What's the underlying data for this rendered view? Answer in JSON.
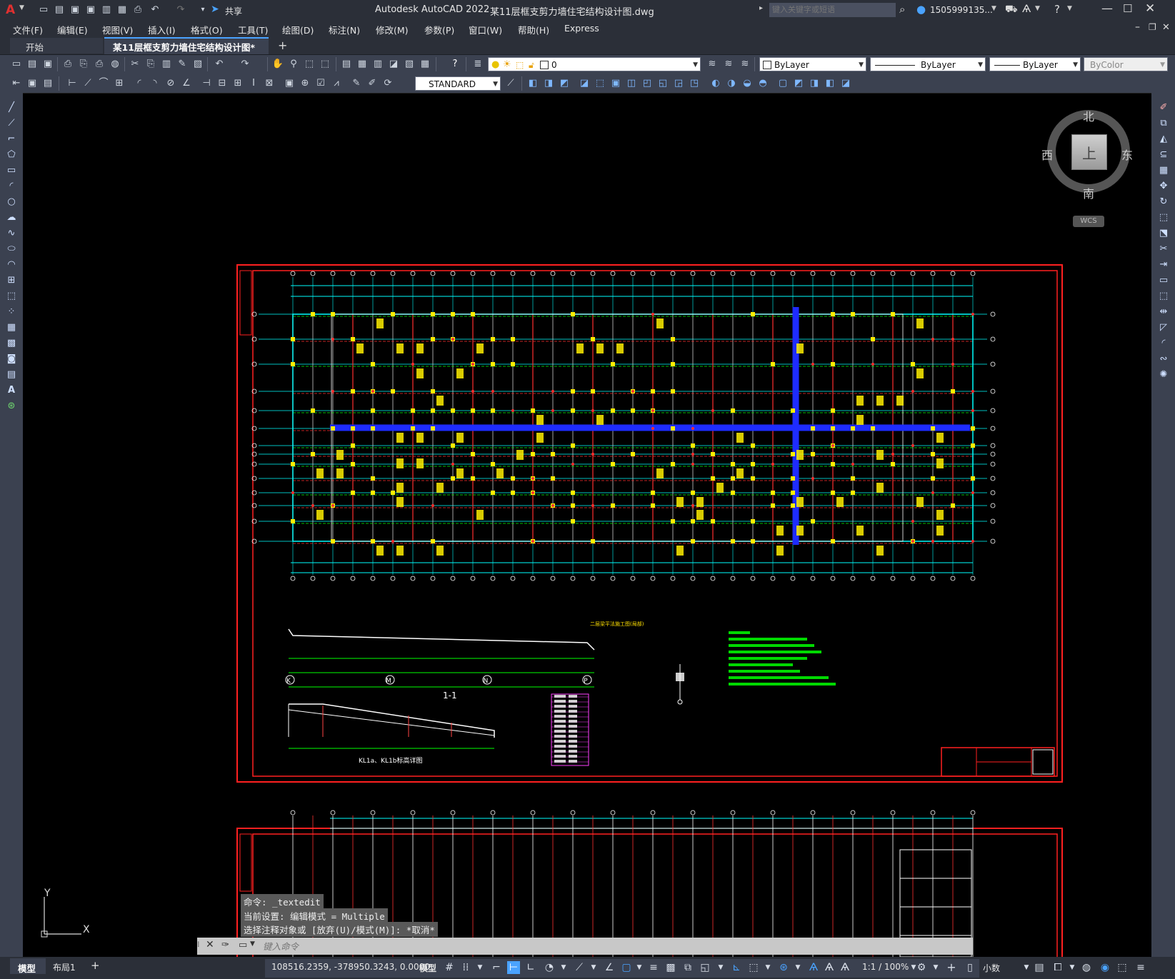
{
  "titlebar": {
    "app_title": "Autodesk AutoCAD 2022",
    "file_title": "某11层框支剪力墙住宅结构设计图.dwg",
    "share_label": "共享",
    "search_placeholder": "键入关键字或短语",
    "user": "1505999135...",
    "app_icon": "A"
  },
  "menu": [
    "文件(F)",
    "编辑(E)",
    "视图(V)",
    "插入(I)",
    "格式(O)",
    "工具(T)",
    "绘图(D)",
    "标注(N)",
    "修改(M)",
    "参数(P)",
    "窗口(W)",
    "帮助(H)",
    "Express"
  ],
  "tabs": {
    "start": "开始",
    "drawing": "某11层框支剪力墙住宅结构设计图*",
    "add": "+"
  },
  "toolbar": {
    "layer_value": "0",
    "color_value": "ByLayer",
    "linetype_value": "ByLayer",
    "lineweight_value": "ByLayer",
    "plotstyle_value": "ByColor",
    "textstyle_value": "STANDARD"
  },
  "viewcube": {
    "north": "北",
    "south": "南",
    "east": "东",
    "west": "西",
    "face": "上",
    "wcs": "WCS"
  },
  "drawing": {
    "section_label": "1-1",
    "beam_label": "KL1a、KL1b标高详图",
    "plan_title": "二层梁平法施工图(局部)",
    "axis_labels": [
      "K",
      "M",
      "N",
      "P"
    ]
  },
  "command": {
    "history": [
      "命令: _textedit",
      "当前设置: 编辑模式 = Multiple",
      "选择注释对象或 [放弃(U)/模式(M)]: *取消*"
    ],
    "placeholder": "键入命令"
  },
  "ucs": {
    "y": "Y",
    "x": "X"
  },
  "status": {
    "model_tab": "模型",
    "layout_tab": "布局1",
    "coords": "108516.2359, -378950.3243, 0.0000",
    "model_label": "模型",
    "scale": "1:1 / 100%",
    "units": "小数"
  }
}
